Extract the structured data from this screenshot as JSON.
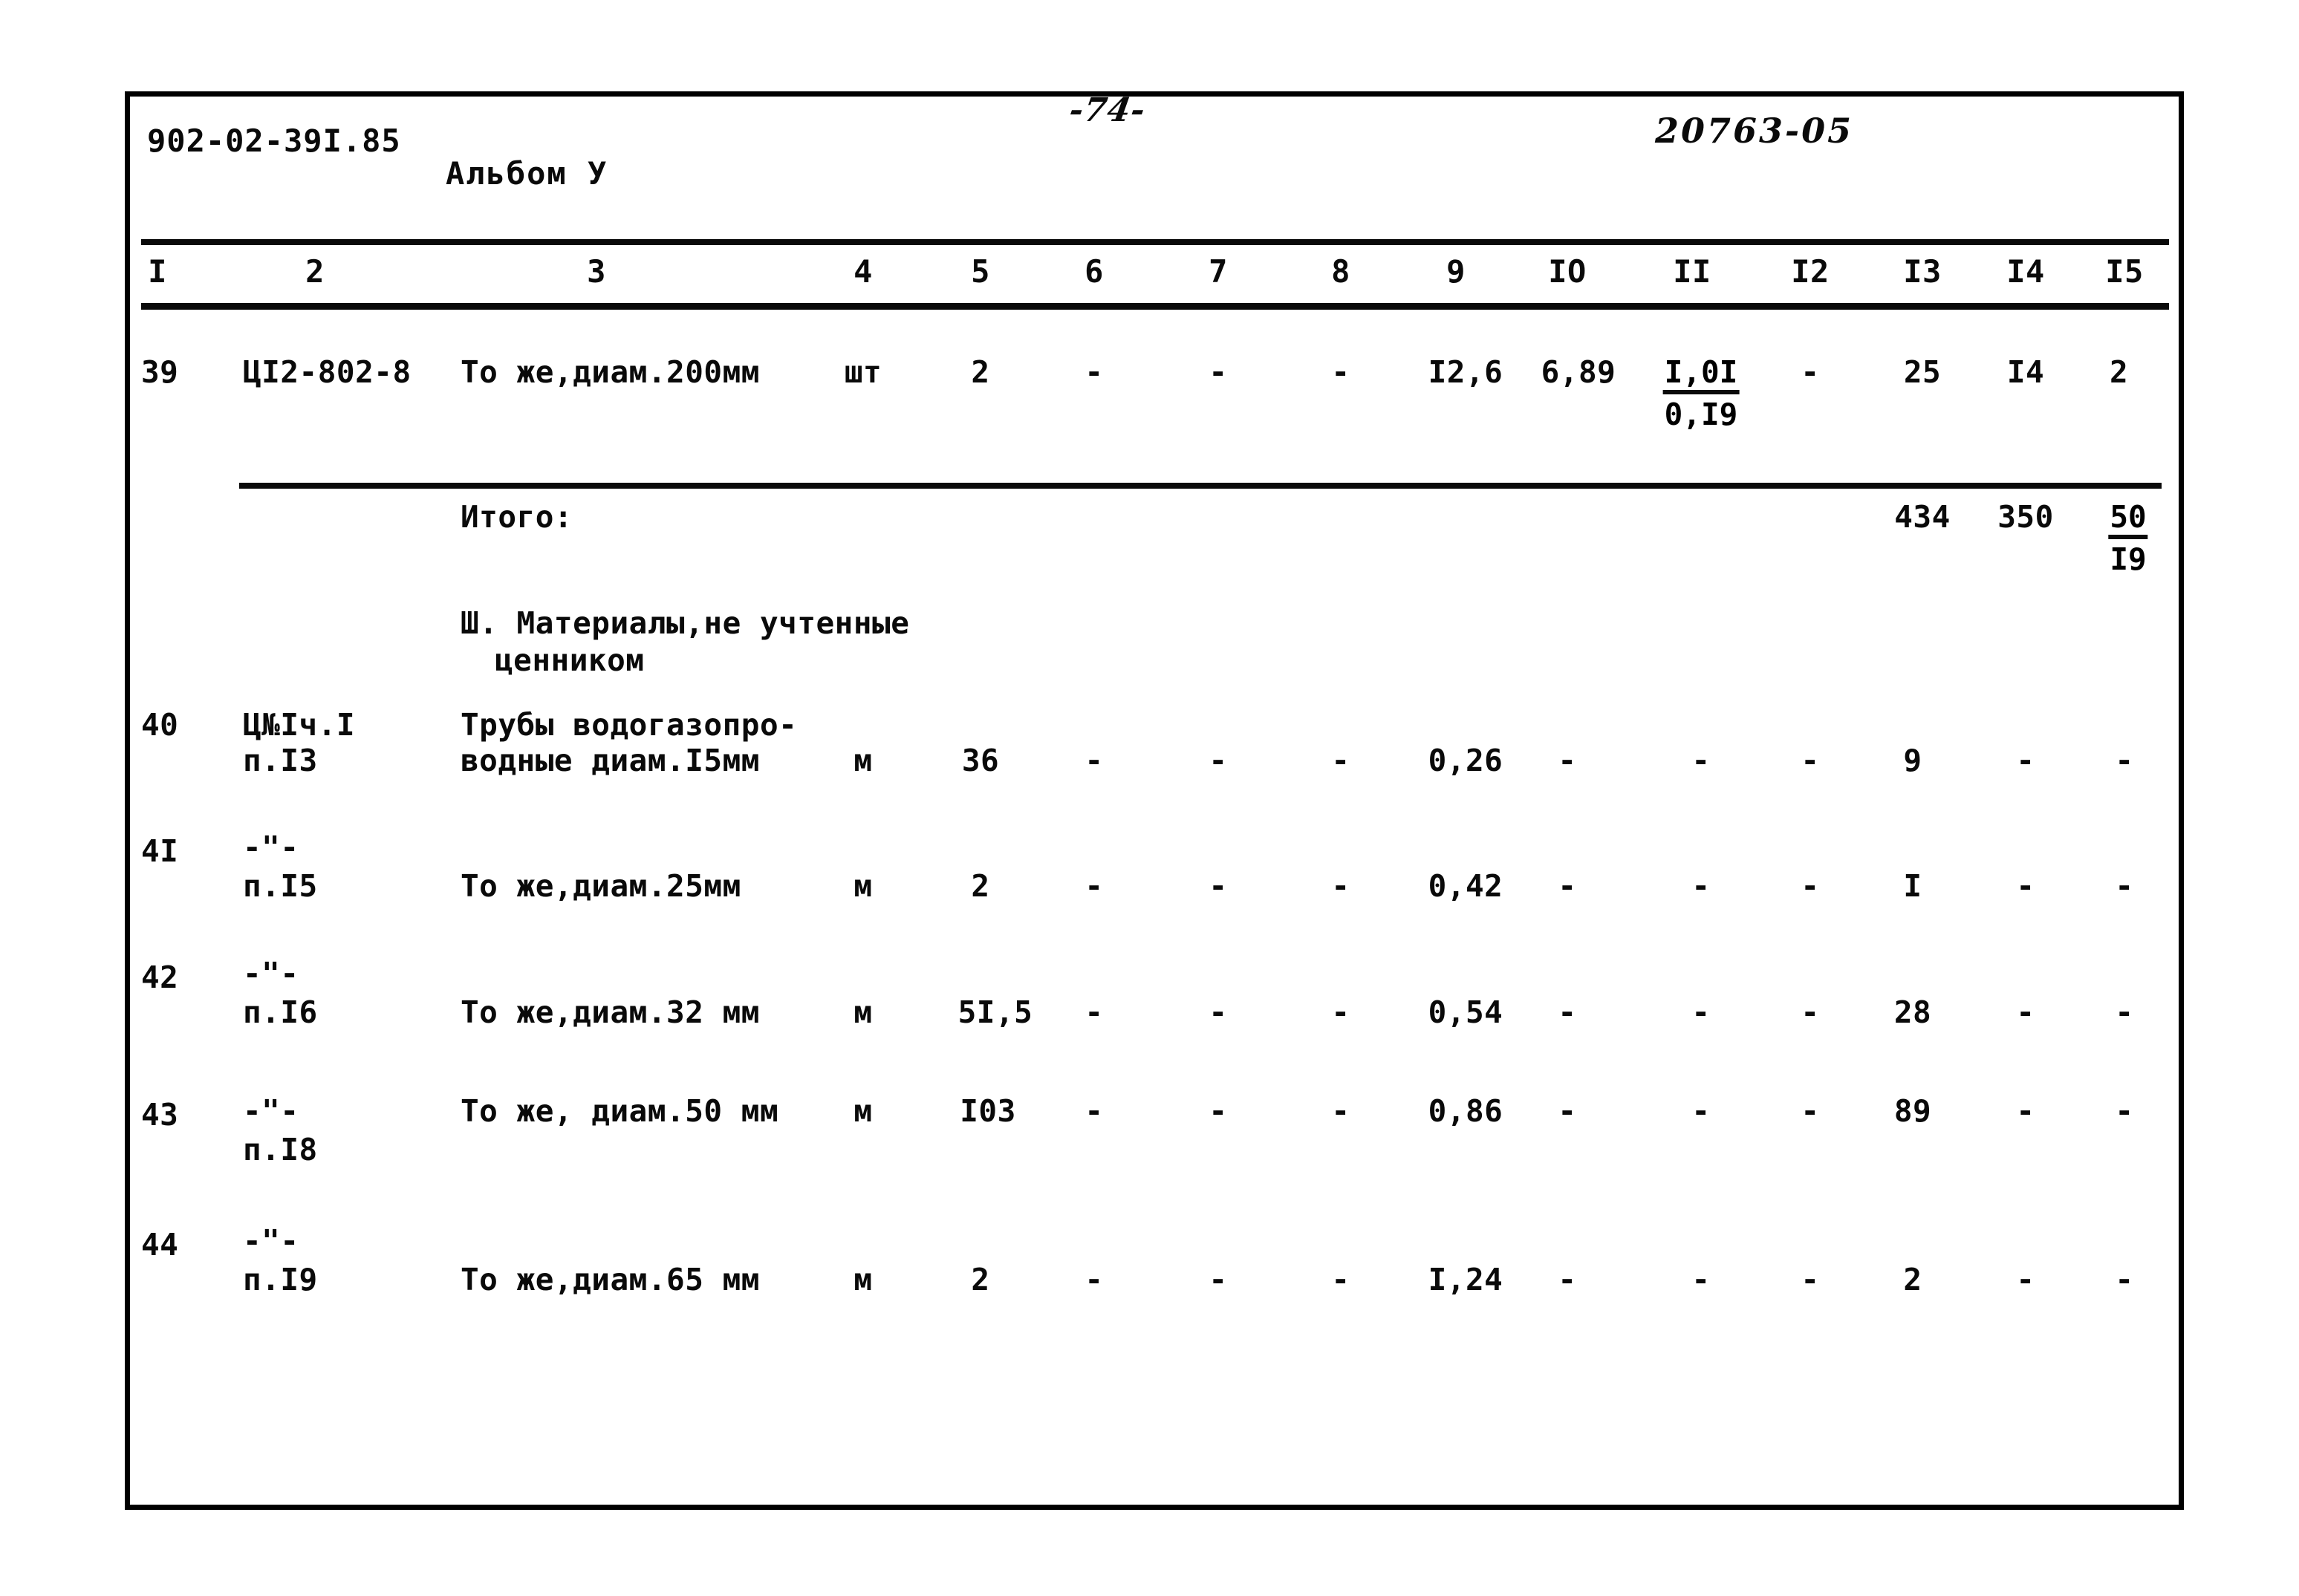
{
  "document": {
    "doc_code": "902-02-39I.85",
    "album": "Альбом У",
    "page_number": "-74-",
    "stamp_code": "20763-05"
  },
  "table": {
    "column_headers": [
      "I",
      "2",
      "3",
      "4",
      "5",
      "6",
      "7",
      "8",
      "9",
      "IO",
      "II",
      "I2",
      "I3",
      "I4",
      "I5"
    ],
    "rows": [
      {
        "c1": "39",
        "c2": "ЦI2-802-8",
        "c3": "То же,диам.200мм",
        "c4": "шт",
        "c5": "2",
        "c6": "-",
        "c7": "-",
        "c8": "-",
        "c9": "I2,6",
        "c10": "6,89",
        "c11_num": "I,0I",
        "c11_den": "0,I9",
        "c12": "-",
        "c13": "25",
        "c14": "I4",
        "c15": "2"
      }
    ],
    "total_row": {
      "label": "Итого:",
      "c13": "434",
      "c14": "350",
      "c15_num": "50",
      "c15_den": "I9"
    },
    "section_heading": {
      "line1": "Ш. Материалы,не учтенные",
      "line2": "ценником"
    },
    "material_rows": [
      {
        "c1": "40",
        "c2_line1": "Ц№Iч.I",
        "c2_line2": "п.I3",
        "c3_line1": "Трубы водогазопро-",
        "c3_line2": "водные диам.I5мм",
        "c4": "м",
        "c5": "36",
        "c6": "-",
        "c7": "-",
        "c8": "-",
        "c9": "0,26",
        "c10": "-",
        "c11": "-",
        "c12": "-",
        "c13": "9",
        "c14": "-",
        "c15": "-"
      },
      {
        "c1": "4I",
        "c2_line1": "-\"-",
        "c2_line2": "п.I5",
        "c3_line1": "",
        "c3_line2": "То же,диам.25мм",
        "c4": "м",
        "c5": "2",
        "c6": "-",
        "c7": "-",
        "c8": "-",
        "c9": "0,42",
        "c10": "-",
        "c11": "-",
        "c12": "-",
        "c13": "I",
        "c14": "-",
        "c15": "-"
      },
      {
        "c1": "42",
        "c2_line1": "-\"-",
        "c2_line2": "п.I6",
        "c3_line1": "",
        "c3_line2": "То же,диам.32 мм",
        "c4": "м",
        "c5": "5I,5",
        "c6": "-",
        "c7": "-",
        "c8": "-",
        "c9": "0,54",
        "c10": "-",
        "c11": "-",
        "c12": "-",
        "c13": "28",
        "c14": "-",
        "c15": "-"
      },
      {
        "c1": "43",
        "c2_line1": "-\"-",
        "c2_line2": "п.I8",
        "c3_line1": "То же, диам.50 мм",
        "c3_line2": "",
        "c4": "м",
        "c5": "I03",
        "c6": "-",
        "c7": "-",
        "c8": "-",
        "c9": "0,86",
        "c10": "-",
        "c11": "-",
        "c12": "-",
        "c13": "89",
        "c14": "-",
        "c15": "-"
      },
      {
        "c1": "44",
        "c2_line1": "-\"-",
        "c2_line2": "п.I9",
        "c3_line1": "",
        "c3_line2": "То же,диам.65 мм",
        "c4": "м",
        "c5": "2",
        "c6": "-",
        "c7": "-",
        "c8": "-",
        "c9": "I,24",
        "c10": "-",
        "c11": "-",
        "c12": "-",
        "c13": "2",
        "c14": "-",
        "c15": "-"
      }
    ]
  }
}
